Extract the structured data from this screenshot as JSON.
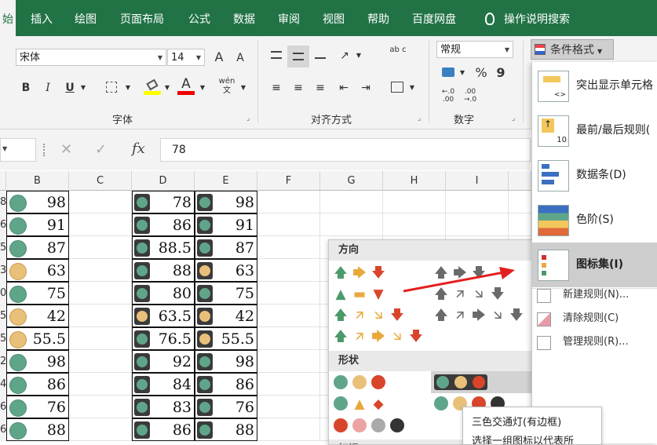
{
  "tabs": [
    {
      "label": "始",
      "active": true
    },
    {
      "label": "插入"
    },
    {
      "label": "绘图"
    },
    {
      "label": "页面布局"
    },
    {
      "label": "公式"
    },
    {
      "label": "数据"
    },
    {
      "label": "审阅"
    },
    {
      "label": "视图"
    },
    {
      "label": "帮助"
    },
    {
      "label": "百度网盘"
    },
    {
      "label": "操作说明搜索",
      "icon": "lightbulb-icon"
    }
  ],
  "font_group": {
    "font_name": "宋体",
    "font_size": "14",
    "grow_label": "A",
    "shrink_label": "A",
    "bold": "B",
    "italic": "I",
    "underline": "U",
    "font_color_glyph": "A",
    "phonetic": "wén文",
    "label": "字体"
  },
  "align_group": {
    "label": "对齐方式",
    "wrap_glyph": "ab c"
  },
  "number_group": {
    "format": "常规",
    "percent": "%",
    "comma": "9",
    "inc_decimal": ".00→.0",
    "label": "数字"
  },
  "cf_button": {
    "label": "条件格式"
  },
  "formula_bar": {
    "cancel": "✕",
    "enter": "✓",
    "fx": "fx",
    "value": "78"
  },
  "columns": [
    "B",
    "C",
    "D",
    "E",
    "F",
    "G",
    "H",
    "I"
  ],
  "row_stubs": [
    "8",
    "6",
    "5",
    "3",
    "0",
    "5",
    "5",
    "2",
    "4",
    "6",
    "6"
  ],
  "rows": [
    {
      "b": "98",
      "b_icon": "green",
      "d": "78",
      "d_icon": "green",
      "e": "98",
      "e_icon": "green"
    },
    {
      "b": "91",
      "b_icon": "green",
      "d": "86",
      "d_icon": "green",
      "e": "91",
      "e_icon": "green"
    },
    {
      "b": "87",
      "b_icon": "green",
      "d": "88.5",
      "d_icon": "green",
      "e": "87",
      "e_icon": "green"
    },
    {
      "b": "63",
      "b_icon": "yellow",
      "d": "88",
      "d_icon": "green",
      "e": "63",
      "e_icon": "yellow"
    },
    {
      "b": "75",
      "b_icon": "green",
      "d": "80",
      "d_icon": "green",
      "e": "75",
      "e_icon": "green"
    },
    {
      "b": "42",
      "b_icon": "yellow",
      "d": "63.5",
      "d_icon": "yellow",
      "e": "42",
      "e_icon": "yellow"
    },
    {
      "b": "55.5",
      "b_icon": "yellow",
      "d": "76.5",
      "d_icon": "green",
      "e": "55.5",
      "e_icon": "yellow"
    },
    {
      "b": "98",
      "b_icon": "green",
      "d": "92",
      "d_icon": "green",
      "e": "98",
      "e_icon": "green"
    },
    {
      "b": "86",
      "b_icon": "green",
      "d": "84",
      "d_icon": "green",
      "e": "86",
      "e_icon": "green"
    },
    {
      "b": "76",
      "b_icon": "green",
      "d": "83",
      "d_icon": "green",
      "e": "76",
      "e_icon": "green"
    },
    {
      "b": "88",
      "b_icon": "green",
      "d": "86",
      "d_icon": "green",
      "e": "88",
      "e_icon": "green"
    }
  ],
  "icon_panel": {
    "direction": "方向",
    "shapes": "形状",
    "indicators": "标记"
  },
  "cf_menu": {
    "items": [
      {
        "label": "突出显示单元格"
      },
      {
        "label": "最前/最后规则("
      },
      {
        "label": "数据条(D)"
      },
      {
        "label": "色阶(S)"
      },
      {
        "label": "图标集(I)",
        "highlight": true
      }
    ],
    "sub_items": [
      {
        "label": "新建规则(N)..."
      },
      {
        "label": "清除规则(C)"
      },
      {
        "label": "管理规则(R)..."
      }
    ]
  },
  "tooltip": {
    "title": "三色交通灯(有边框)",
    "desc": "选择一组图标以代表所"
  },
  "colors": {
    "green": "#5fa58a",
    "yellow": "#e9c07a",
    "red": "#d9452b",
    "accent": "#217346"
  }
}
